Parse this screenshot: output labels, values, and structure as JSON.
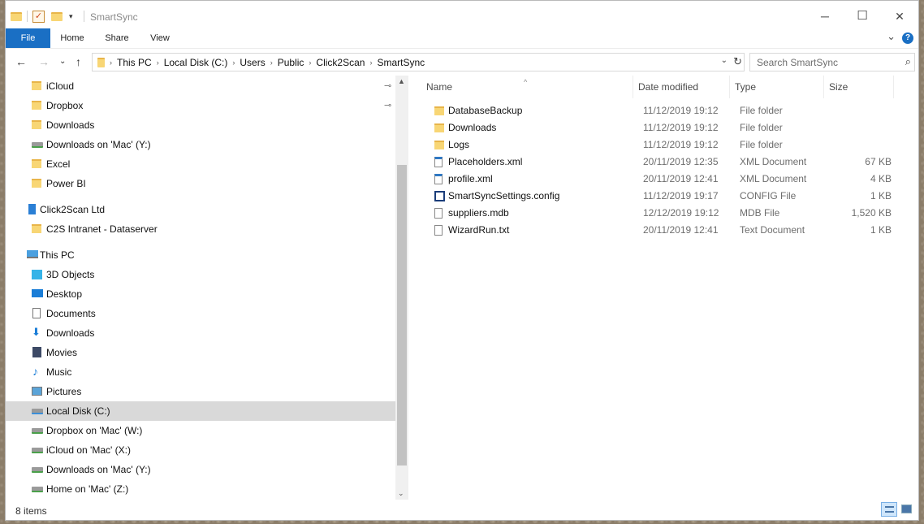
{
  "window": {
    "title": "SmartSync"
  },
  "controls": {
    "minimize": "─",
    "maximize": "☐",
    "close": "✕"
  },
  "ribbon": {
    "tabs": [
      "File",
      "Home",
      "Share",
      "View"
    ]
  },
  "address": {
    "crumbs": [
      "This PC",
      "Local Disk (C:)",
      "Users",
      "Public",
      "Click2Scan",
      "SmartSync"
    ]
  },
  "search": {
    "placeholder": "Search SmartSync"
  },
  "nav": {
    "quick_access": [
      {
        "label": "iCloud",
        "icon": "folder-icon",
        "pinned": true
      },
      {
        "label": "Dropbox",
        "icon": "folder-icon",
        "pinned": true
      },
      {
        "label": "Downloads",
        "icon": "folder-icon"
      },
      {
        "label": "Downloads on 'Mac' (Y:)",
        "icon": "network-drive-icon"
      },
      {
        "label": "Excel",
        "icon": "folder-icon"
      },
      {
        "label": "Power BI",
        "icon": "folder-icon"
      }
    ],
    "org": {
      "label": "Click2Scan Ltd",
      "icon": "organization-icon"
    },
    "org_items": [
      {
        "label": "C2S Intranet - Dataserver",
        "icon": "folder-icon"
      }
    ],
    "this_pc": {
      "label": "This PC",
      "icon": "computer-icon"
    },
    "pc_items": [
      {
        "label": "3D Objects",
        "icon": "3d-objects-icon"
      },
      {
        "label": "Desktop",
        "icon": "desktop-icon"
      },
      {
        "label": "Documents",
        "icon": "documents-icon"
      },
      {
        "label": "Downloads",
        "icon": "downloads-icon"
      },
      {
        "label": "Movies",
        "icon": "movies-icon"
      },
      {
        "label": "Music",
        "icon": "music-icon"
      },
      {
        "label": "Pictures",
        "icon": "pictures-icon"
      },
      {
        "label": "Local Disk (C:)",
        "icon": "local-disk-icon",
        "selected": true
      },
      {
        "label": "Dropbox on 'Mac' (W:)",
        "icon": "network-drive-icon"
      },
      {
        "label": "iCloud on 'Mac' (X:)",
        "icon": "network-drive-icon"
      },
      {
        "label": "Downloads on 'Mac' (Y:)",
        "icon": "network-drive-icon"
      },
      {
        "label": "Home on 'Mac' (Z:)",
        "icon": "network-drive-icon"
      }
    ]
  },
  "files": {
    "columns": [
      "Name",
      "Date modified",
      "Type",
      "Size"
    ],
    "rows": [
      {
        "name": "DatabaseBackup",
        "date": "11/12/2019 19:12",
        "type": "File folder",
        "size": "",
        "icon": "folder-icon"
      },
      {
        "name": "Downloads",
        "date": "11/12/2019 19:12",
        "type": "File folder",
        "size": "",
        "icon": "folder-icon"
      },
      {
        "name": "Logs",
        "date": "11/12/2019 19:12",
        "type": "File folder",
        "size": "",
        "icon": "folder-icon"
      },
      {
        "name": "Placeholders.xml",
        "date": "20/11/2019 12:35",
        "type": "XML Document",
        "size": "67 KB",
        "icon": "xml-file-icon"
      },
      {
        "name": "profile.xml",
        "date": "20/11/2019 12:41",
        "type": "XML Document",
        "size": "4 KB",
        "icon": "xml-file-icon"
      },
      {
        "name": "SmartSyncSettings.config",
        "date": "11/12/2019 19:17",
        "type": "CONFIG File",
        "size": "1 KB",
        "icon": "config-file-icon"
      },
      {
        "name": "suppliers.mdb",
        "date": "12/12/2019 19:12",
        "type": "MDB File",
        "size": "1,520 KB",
        "icon": "file-icon"
      },
      {
        "name": "WizardRun.txt",
        "date": "20/11/2019 12:41",
        "type": "Text Document",
        "size": "1 KB",
        "icon": "text-file-icon"
      }
    ]
  },
  "status": {
    "count": "8 items"
  },
  "colors": {
    "accent": "#1a6fc4",
    "selected_row": "#d9d9d9",
    "folder": "#f8d675"
  }
}
